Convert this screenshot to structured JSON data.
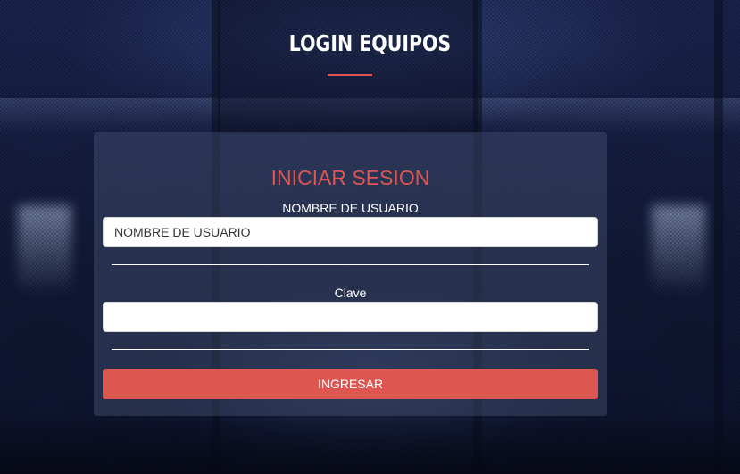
{
  "page": {
    "title": "LOGIN EQUIPOS"
  },
  "login": {
    "heading": "INICIAR SESION",
    "username_label": "NOMBRE DE USUARIO",
    "username_placeholder": "NOMBRE DE USUARIO",
    "password_label": "Clave",
    "password_value": "",
    "submit_label": "INGRESAR"
  },
  "colors": {
    "accent": "#e05551",
    "button": "#de5650",
    "background": "#141c3a"
  }
}
